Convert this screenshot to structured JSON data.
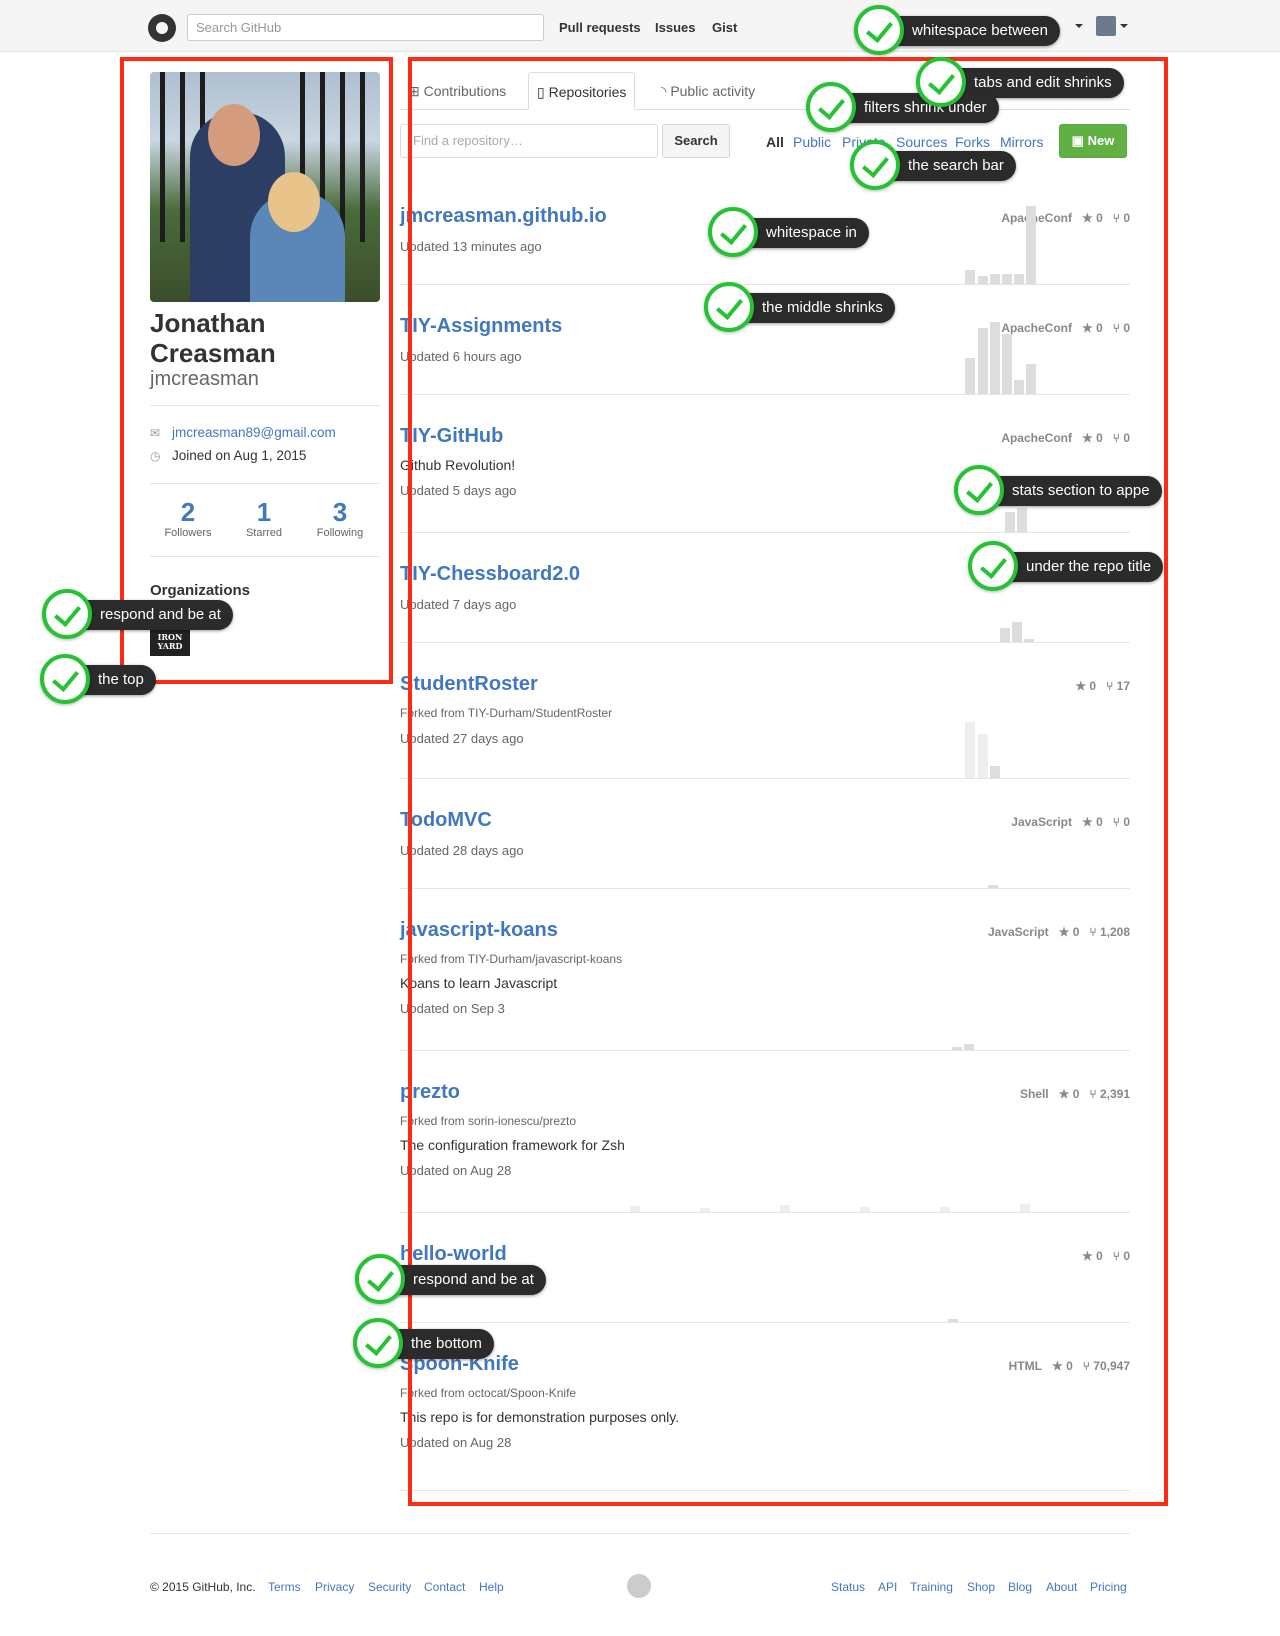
{
  "header": {
    "search_placeholder": "Search GitHub",
    "nav": [
      "Pull requests",
      "Issues",
      "Gist"
    ]
  },
  "profile": {
    "name_line1": "Jonathan",
    "name_line2": "Creasman",
    "username": "jmcreasman",
    "email": "jmcreasman89@gmail.com",
    "joined": "Joined on Aug 1, 2015",
    "stats": [
      {
        "num": "2",
        "label": "Followers"
      },
      {
        "num": "1",
        "label": "Starred"
      },
      {
        "num": "3",
        "label": "Following"
      }
    ],
    "organizations_label": "Organizations",
    "org_logo_text": "IRON YARD"
  },
  "tabs": [
    "Contributions",
    "Repositories",
    "Public activity"
  ],
  "repo_filter": {
    "placeholder": "Find a repository…",
    "search_label": "Search",
    "filters": [
      "All",
      "Public",
      "Private",
      "Sources",
      "Forks",
      "Mirrors"
    ],
    "new_label": "New"
  },
  "repos": [
    {
      "title": "jmcreasman.github.io",
      "updated": "Updated 13 minutes ago",
      "lang": "ApacheConf",
      "stars": "0",
      "forks": "0"
    },
    {
      "title": "TIY-Assignments",
      "updated": "Updated 6 hours ago",
      "lang": "ApacheConf",
      "stars": "0",
      "forks": "0"
    },
    {
      "title": "TIY-GitHub",
      "desc": "Github Revolution!",
      "updated": "Updated 5 days ago",
      "lang": "ApacheConf",
      "stars": "0",
      "forks": "0"
    },
    {
      "title": "TIY-Chessboard2.0",
      "updated": "Updated 7 days ago",
      "lang": "",
      "stars": "",
      "forks": ""
    },
    {
      "title": "StudentRoster",
      "forked": "Forked from TIY-Durham/StudentRoster",
      "updated": "Updated 27 days ago",
      "lang": "",
      "stars": "0",
      "forks": "17"
    },
    {
      "title": "TodoMVC",
      "updated": "Updated 28 days ago",
      "lang": "JavaScript",
      "stars": "0",
      "forks": "0"
    },
    {
      "title": "javascript-koans",
      "forked": "Forked from TIY-Durham/javascript-koans",
      "desc": "Koans to learn Javascript",
      "updated": "Updated on Sep 3",
      "lang": "JavaScript",
      "stars": "0",
      "forks": "1,208"
    },
    {
      "title": "prezto",
      "forked": "Forked from sorin-ionescu/prezto",
      "desc": "The configuration framework for Zsh",
      "updated": "Updated on Aug 28",
      "lang": "Shell",
      "stars": "0",
      "forks": "2,391"
    },
    {
      "title": "hello-world",
      "lang": "",
      "stars": "0",
      "forks": "0"
    },
    {
      "title": "Spoon-Knife",
      "forked": "Forked from octocat/Spoon-Knife",
      "desc": "This repo is for demonstration purposes only.",
      "updated": "Updated on Aug 28",
      "lang": "HTML",
      "stars": "0",
      "forks": "70,947"
    }
  ],
  "footer": {
    "copyright": "© 2015 GitHub, Inc.",
    "left_links": [
      "Terms",
      "Privacy",
      "Security",
      "Contact",
      "Help"
    ],
    "right_links": [
      "Status",
      "API",
      "Training",
      "Shop",
      "Blog",
      "About",
      "Pricing"
    ]
  },
  "annotations": [
    "whitespace between",
    "tabs and edit shrinks",
    "filters shrink under",
    "the search bar",
    "whitespace in",
    "the middle shrinks",
    "stats section to appe",
    "under the repo title",
    "respond and be at",
    "the top",
    "respond and be at",
    "the bottom"
  ],
  "colors": {
    "link": "#4078c0",
    "new_button": "#60b044",
    "highlight_box": "#ff2b14",
    "check": "#25c234"
  }
}
